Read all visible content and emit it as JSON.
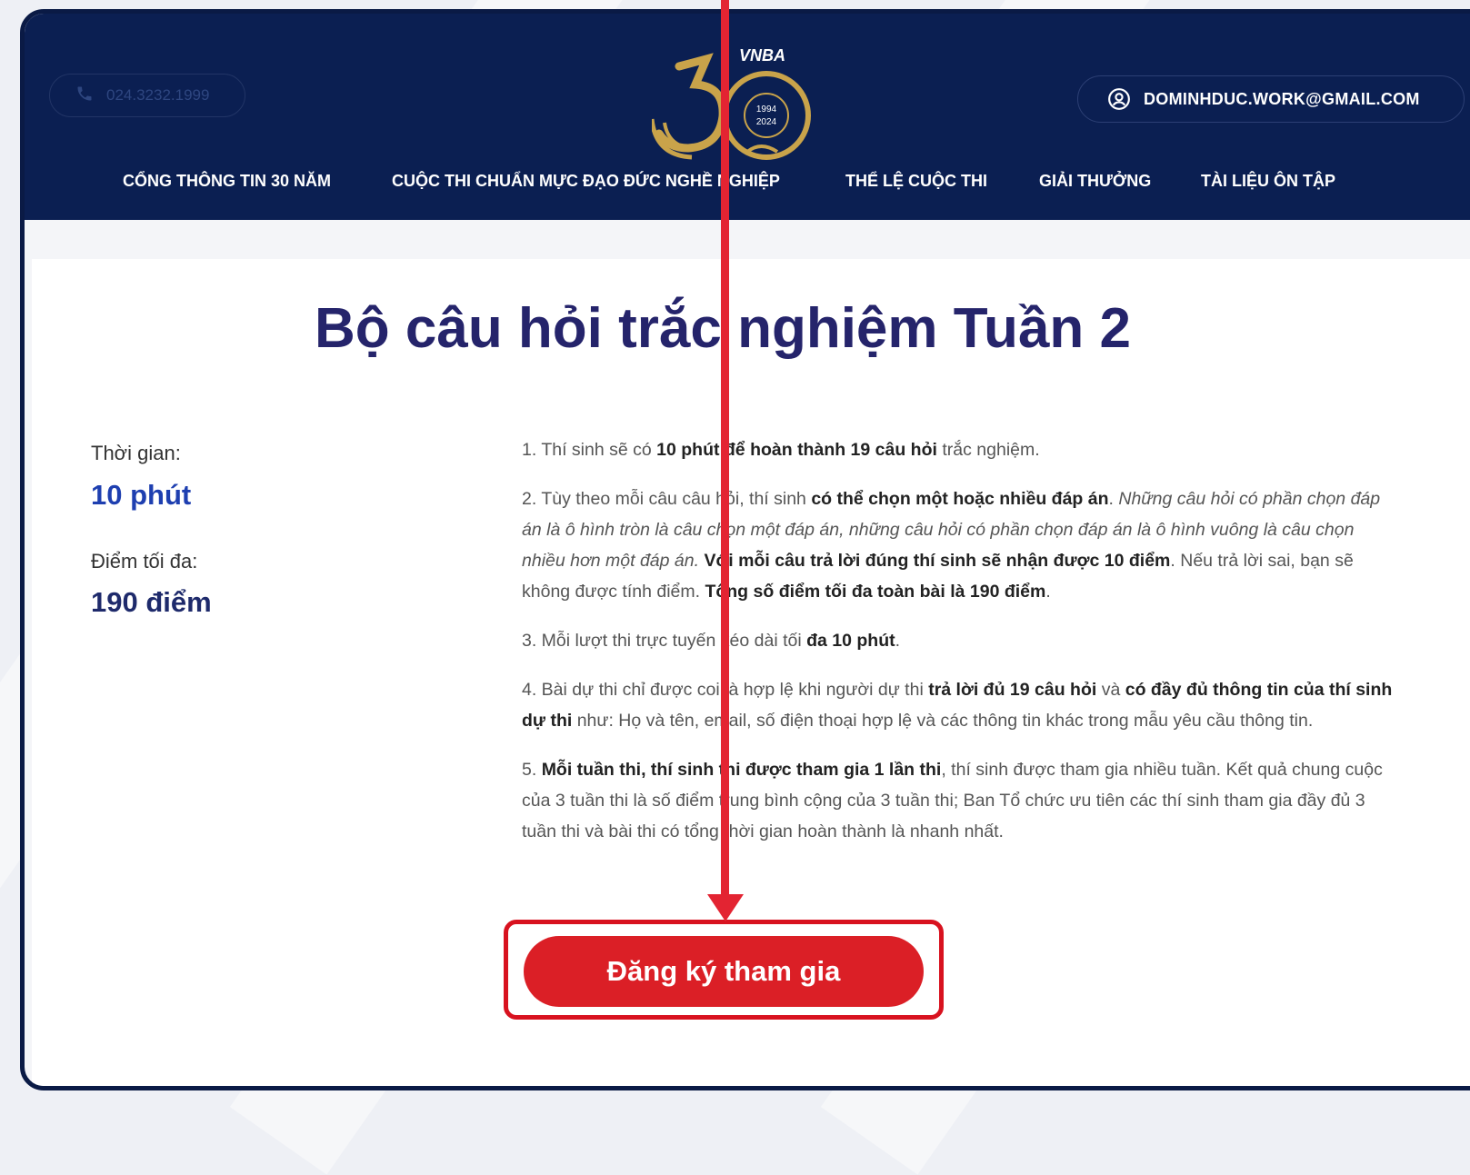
{
  "header": {
    "phone": "024.3232.1999",
    "logo": {
      "text": "VNBA",
      "years": [
        "1994",
        "2024"
      ]
    },
    "account_email": "DOMINHDUC.WORK@GMAIL.COM"
  },
  "nav": {
    "items": [
      {
        "label": "CỔNG THÔNG TIN 30 NĂM"
      },
      {
        "label": "CUỘC THI CHUẨN MỰC ĐẠO ĐỨC NGHỀ NGHIỆP"
      },
      {
        "label": "THỂ LỆ CUỘC THI"
      },
      {
        "label": "GIẢI THƯỞNG"
      },
      {
        "label": "TÀI LIỆU ÔN TẬP"
      }
    ]
  },
  "main": {
    "title": "Bộ câu hỏi trắc nghiệm Tuần 2",
    "time_label": "Thời gian:",
    "time_value": "10 phút",
    "score_label": "Điểm tối đa:",
    "score_value": "190 điểm",
    "rules": {
      "r1": {
        "a": "1. Thí sinh sẽ có ",
        "b": "10 phút để hoàn thành 19 câu hỏi",
        "c": " trắc nghiệm."
      },
      "r2": {
        "a": "2. Tùy theo mỗi câu câu hỏi, thí sinh ",
        "b": "có thể chọn một hoặc nhiều đáp án",
        "c": ". ",
        "d": "Những câu hỏi có phần chọn đáp án là ô hình tròn là câu chọn một đáp án, những câu hỏi có phần chọn đáp án là ô hình vuông là câu chọn nhiều hơn một đáp án.",
        "e": " ",
        "f": "Với mỗi câu trả lời đúng thí sinh sẽ nhận được 10 điểm",
        "g": ". Nếu trả lời sai, bạn sẽ không được tính điểm. ",
        "h": "Tổng số điểm tối đa toàn bài là 190 điểm",
        "i": "."
      },
      "r3": {
        "a": "3. Mỗi lượt thi trực tuyến kéo dài tối ",
        "b": "đa 10 phút",
        "c": "."
      },
      "r4": {
        "a": "4. Bài dự thi chỉ được coi là hợp lệ khi người dự thi ",
        "b": "trả lời đủ 19 câu hỏi",
        "c": " và ",
        "d": "có đầy đủ thông tin của thí sinh dự thi",
        "e": " như: Họ và tên, email, số điện thoại hợp lệ và các thông tin khác trong mẫu yêu cầu thông tin."
      },
      "r5": {
        "a": "5. ",
        "b": "Mỗi tuần thi, thí sinh thi được tham gia 1 lần thi",
        "c": ", thí sinh được tham gia nhiều tuần. Kết quả chung cuộc của 3 tuần thi là số điểm trung bình cộng của 3 tuần thi; Ban Tổ chức ưu tiên các thí sinh tham gia đầy đủ 3 tuần thi và bài thi có tổng thời gian hoàn thành là nhanh nhất."
      }
    },
    "register_button": "Đăng ký tham gia"
  },
  "colors": {
    "header_bg": "#0b1f52",
    "title": "#25246b",
    "value_blue": "#1e3fb0",
    "button_red": "#db1f26",
    "annotation_red": "#e32432",
    "logo_gold": "#c9a34a"
  },
  "icons": {
    "phone": "phone-icon",
    "account": "user-circle-icon",
    "annotation": "arrow-down-icon"
  }
}
